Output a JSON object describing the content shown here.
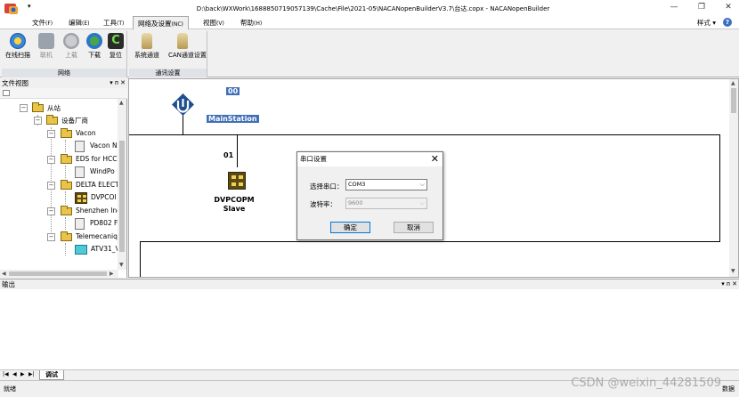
{
  "window": {
    "title": "D:\\back\\WXWork\\1688850719057139\\Cache\\File\\2021-05\\NACANopenBuilderV3.7\\台达.copx - NACANopenBuilder",
    "quick_access_arrow": "▾",
    "minimize": "—",
    "restore": "❐",
    "close": "✕"
  },
  "menu": {
    "items": [
      {
        "label": "文件",
        "hotkey": "(F)"
      },
      {
        "label": "编辑",
        "hotkey": "(E)"
      },
      {
        "label": "工具",
        "hotkey": "(T)"
      },
      {
        "label": "网络及设置",
        "hotkey": "(NC)"
      },
      {
        "label": "视图",
        "hotkey": "(V)"
      },
      {
        "label": "帮助",
        "hotkey": "(H)"
      }
    ],
    "style_label": "样式 ▾",
    "help_icon": "?"
  },
  "ribbon": {
    "groups": [
      {
        "label": "网络",
        "buttons": [
          {
            "label": "在线扫描",
            "icon": "scan-icon",
            "enabled": true
          },
          {
            "label": "联机",
            "icon": "connect-icon",
            "enabled": false
          },
          {
            "label": "上载",
            "icon": "upload-icon",
            "enabled": false
          },
          {
            "label": "下载",
            "icon": "download-icon",
            "enabled": true
          },
          {
            "label": "复位",
            "icon": "reset-icon",
            "enabled": true
          }
        ]
      },
      {
        "label": "通讯设置",
        "buttons": [
          {
            "label": "系统通道",
            "icon": "system-channel-icon",
            "enabled": true
          },
          {
            "label": "CAN通道设置",
            "icon": "can-channel-icon",
            "enabled": true
          }
        ]
      }
    ]
  },
  "file_view": {
    "title": "文件视图",
    "controls": "▾ ᴨ ✕",
    "tree": [
      {
        "label": "从站",
        "level": 0,
        "type": "folder"
      },
      {
        "label": "设备厂商",
        "level": 1,
        "type": "folder"
      },
      {
        "label": "Vacon",
        "level": 2,
        "type": "folder"
      },
      {
        "label": "Vacon N",
        "level": 3,
        "type": "device"
      },
      {
        "label": "EDS for HCC",
        "level": 2,
        "type": "folder"
      },
      {
        "label": "WindPo",
        "level": 3,
        "type": "device"
      },
      {
        "label": "DELTA ELECT",
        "level": 2,
        "type": "folder"
      },
      {
        "label": "DVPCOI",
        "level": 3,
        "type": "device"
      },
      {
        "label": "Shenzhen Ine",
        "level": 2,
        "type": "folder"
      },
      {
        "label": "PD802 F",
        "level": 3,
        "type": "device"
      },
      {
        "label": "Telemecaniq",
        "level": 2,
        "type": "folder"
      },
      {
        "label": "ATV31_V",
        "level": 3,
        "type": "device"
      }
    ]
  },
  "network": {
    "master_address": "00",
    "master_label": "MainStation",
    "slave_address": "01",
    "slave_label_line1": "DVPCOPM",
    "slave_label_line2": "Slave"
  },
  "dialog": {
    "title": "串口设置",
    "port_label": "选择串口：",
    "port_value": "COM3",
    "baud_label": "波特率：",
    "baud_value": "9600",
    "ok": "确定",
    "cancel": "取消"
  },
  "output": {
    "title": "输出",
    "controls": "▾ ᴨ ✕",
    "tab_label": "调试"
  },
  "status": {
    "left": "就绪",
    "right": "数据"
  },
  "watermark": "CSDN @weixin_44281509",
  "colors": {
    "selection_blue": "#3f6fb6",
    "folder_yellow": "#e8c44a"
  }
}
